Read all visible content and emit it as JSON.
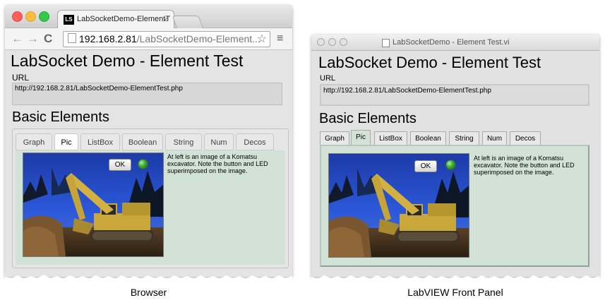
{
  "browser": {
    "tab_title": "LabSocketDemo-ElementT",
    "tab_close": "×",
    "favicon_text": "LS",
    "nav": {
      "back": "←",
      "forward": "→",
      "reload": "C",
      "star": "☆",
      "menu": "≡"
    },
    "address_host": "192.168.2.81",
    "address_path": "/LabSocketDemo-Element...",
    "page": {
      "title": "LabSocket Demo - Element Test",
      "url_label": "URL",
      "url_value": "http://192.168.2.81/LabSocketDemo-ElementTest.php",
      "section_title": "Basic Elements",
      "tabs": [
        "Graph",
        "Pic",
        "ListBox",
        "Boolean",
        "String",
        "Num",
        "Decos"
      ],
      "active_tab": "Pic",
      "ok_label": "OK",
      "description": "At left is an image of a Komatsu excavator. Note the button and LED superimposed on the image."
    }
  },
  "labview": {
    "window_title": "LabSocketDemo - Element Test.vi",
    "page": {
      "title": "LabSocket Demo - Element Test",
      "url_label": "URL",
      "url_value": "http://192.168.2.81/LabSocketDemo-ElementTest.php",
      "section_title": "Basic Elements",
      "tabs": [
        "Graph",
        "Pic",
        "ListBox",
        "Boolean",
        "String",
        "Num",
        "Decos"
      ],
      "active_tab": "Pic",
      "ok_label": "OK",
      "description": "At left is an image of a Komatsu excavator.  Note the button and LED superimposed on the image."
    }
  },
  "captions": {
    "browser": "Browser",
    "labview": "LabVIEW Front Panel"
  },
  "colors": {
    "panel_bg": "#d3e2d6",
    "led_on": "#3fae3a",
    "mac_red": "#fc605c",
    "mac_yellow": "#fdbc40",
    "mac_green": "#34c84a"
  }
}
